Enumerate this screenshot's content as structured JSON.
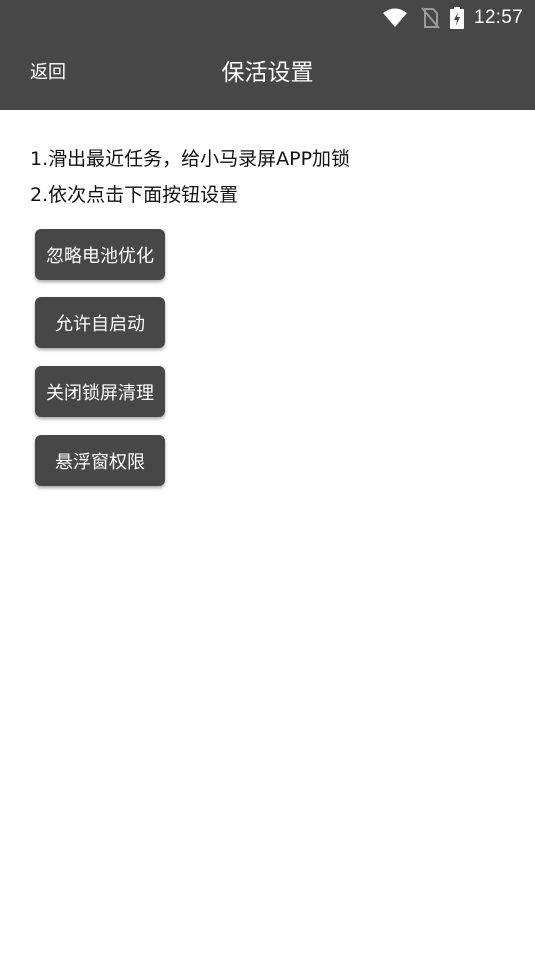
{
  "status_bar": {
    "time": "12:57",
    "icons": [
      "wifi-icon",
      "no-sim-icon",
      "battery-charging-icon"
    ]
  },
  "header": {
    "back_label": "返回",
    "title": "保活设置"
  },
  "instructions": [
    "1.滑出最近任务，给小马录屏APP加锁",
    "2.依次点击下面按钮设置"
  ],
  "buttons": [
    {
      "label": "忽略电池优化"
    },
    {
      "label": "允许自启动"
    },
    {
      "label": "关闭锁屏清理"
    },
    {
      "label": "悬浮窗权限"
    }
  ],
  "colors": {
    "bar_background": "#474747",
    "button_background": "#474747",
    "page_background": "#ffffff",
    "text": "#111111"
  }
}
